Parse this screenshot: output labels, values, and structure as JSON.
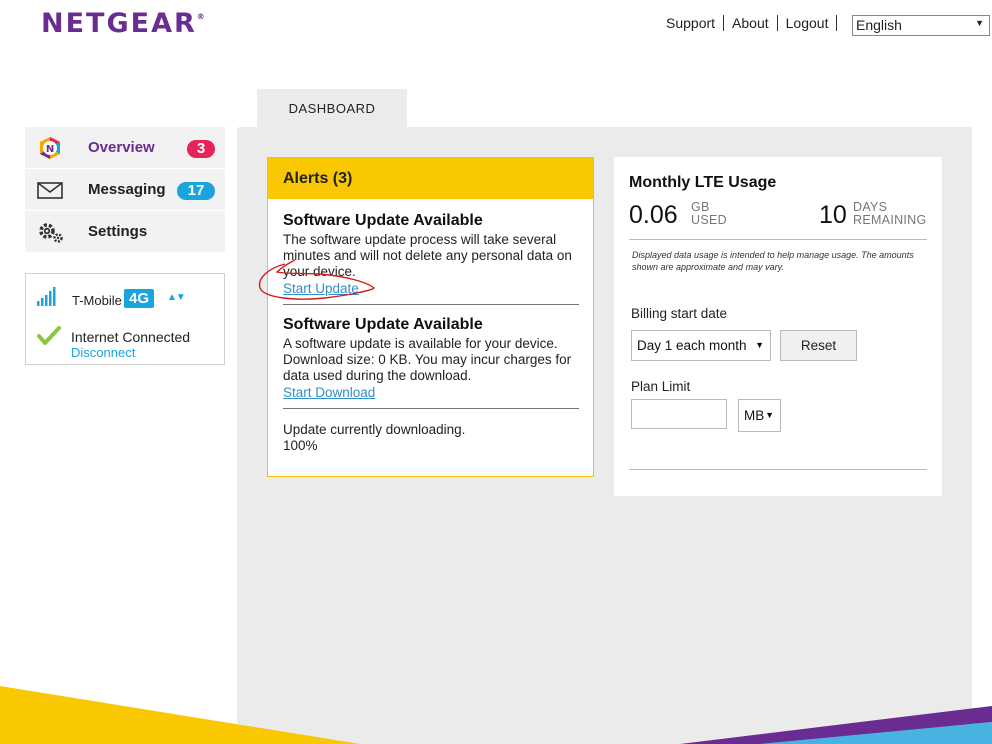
{
  "brand": {
    "name": "NETGEAR",
    "mark": "®",
    "colors": {
      "purple": "#6b2c91",
      "yellow": "#f9c800",
      "blue": "#19a4de",
      "pink": "#e6245b"
    }
  },
  "topnav": {
    "support": "Support",
    "about": "About",
    "logout": "Logout",
    "language": "English"
  },
  "tabs": [
    {
      "label": "DASHBOARD",
      "active": true
    }
  ],
  "sidebar": {
    "items": [
      {
        "label": "Overview",
        "badge": "3",
        "icon": "netgear-n-icon"
      },
      {
        "label": "Messaging",
        "badge": "17",
        "icon": "envelope-icon"
      },
      {
        "label": "Settings",
        "badge": "",
        "icon": "gears-icon"
      }
    ]
  },
  "connection": {
    "carrier": "T-Mobile",
    "network": "4G",
    "status": "Internet Connected",
    "action": "Disconnect"
  },
  "alerts": {
    "title": "Alerts (3)",
    "items": [
      {
        "title": "Software Update Available",
        "text": "The software update process will take several minutes and will not delete any personal data on your device.",
        "link": "Start Update"
      },
      {
        "title": "Software Update Available",
        "text": "A software update is available for your device. Download size: 0 KB. You may incur charges for data used during the download.",
        "link": "Start Download"
      },
      {
        "text": "Update currently downloading.",
        "progress": "100%"
      }
    ]
  },
  "usage": {
    "title": "Monthly LTE Usage",
    "used_value": "0.06",
    "used_unit_top": "GB",
    "used_unit_bottom": "USED",
    "days_value": "10",
    "days_unit_top": "DAYS",
    "days_unit_bottom": "REMAINING",
    "disclaimer": "Displayed data usage is intended to help manage usage. The amounts shown are approximate and may vary.",
    "billing_label": "Billing start date",
    "billing_value": "Day 1 each month",
    "reset_label": "Reset",
    "plan_label": "Plan Limit",
    "plan_value": "",
    "plan_unit": "MB"
  }
}
